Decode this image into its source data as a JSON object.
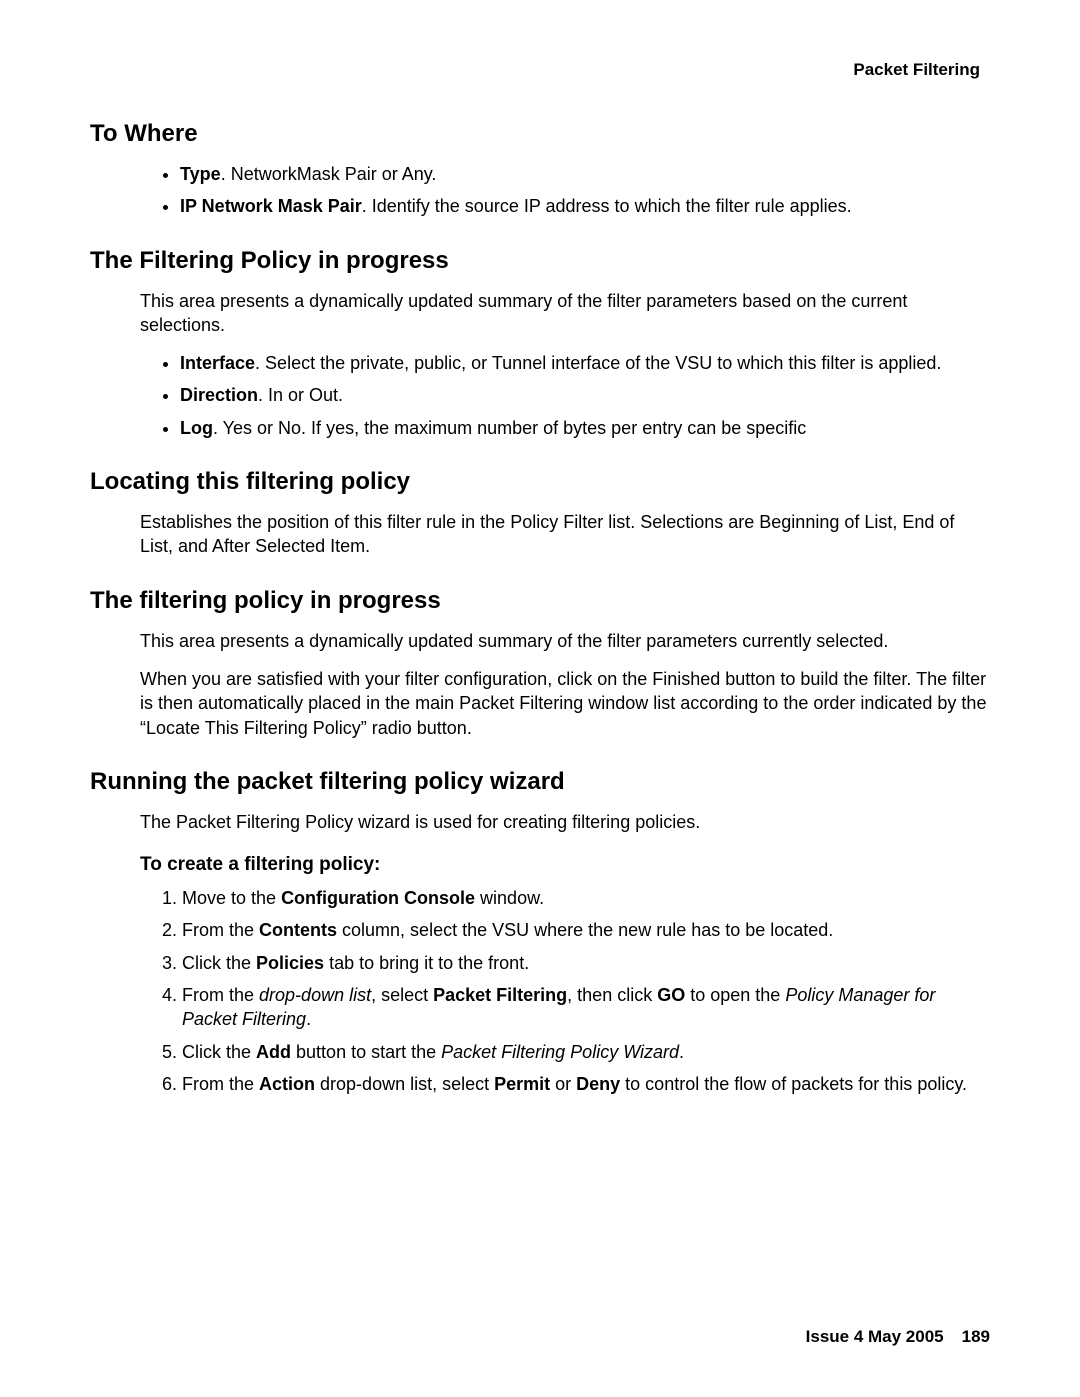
{
  "header": {
    "title": "Packet Filtering"
  },
  "sections": {
    "to_where": {
      "heading": "To Where",
      "bullets": {
        "type_label": "Type",
        "type_text": ". NetworkMask Pair or Any.",
        "ipm_label": "IP Network Mask Pair",
        "ipm_text": ". Identify the source IP address to which the filter rule applies."
      }
    },
    "filtering_progress_upper": {
      "heading": "The Filtering Policy in progress",
      "intro": "This area presents a dynamically updated summary of the filter parameters based on the current selections.",
      "bullets": {
        "interface_label": "Interface",
        "interface_text": ". Select the private, public, or Tunnel interface of the VSU to which this filter is applied.",
        "direction_label": "Direction",
        "direction_text": ". In or Out.",
        "log_label": "Log",
        "log_text": ". Yes or No. If yes, the maximum number of bytes per entry can be specific"
      }
    },
    "locating": {
      "heading": "Locating this filtering policy",
      "para": "Establishes the position of this filter rule in the Policy Filter list. Selections are Beginning of List, End of List, and After Selected Item."
    },
    "filtering_progress_lower": {
      "heading": "The filtering policy in progress",
      "para1": "This area presents a dynamically updated summary of the filter parameters currently selected.",
      "para2": "When you are satisfied with your filter configuration, click on the Finished button to build the filter. The filter is then automatically placed in the main Packet Filtering window list according to the order indicated by the “Locate This Filtering Policy” radio button."
    },
    "running_wizard": {
      "heading": "Running the packet filtering policy wizard",
      "intro": "The Packet Filtering Policy wizard is used for creating filtering policies.",
      "subhead": "To create a filtering policy:",
      "steps": {
        "s1a": "Move to the ",
        "s1b": "Configuration Console",
        "s1c": " window.",
        "s2a": "From the ",
        "s2b": "Contents",
        "s2c": " column, select the VSU where the new rule has to be located.",
        "s3a": "Click the ",
        "s3b": "Policies",
        "s3c": " tab to bring it to the front.",
        "s4a": "From the ",
        "s4b": "drop-down list",
        "s4c": ", select ",
        "s4d": "Packet Filtering",
        "s4e": ", then click ",
        "s4f": "GO",
        "s4g": " to open the ",
        "s4h": "Policy Manager for Packet Filtering",
        "s4i": ".",
        "s5a": "Click the ",
        "s5b": "Add",
        "s5c": " button to start the ",
        "s5d": "Packet Filtering Policy Wizard",
        "s5e": ".",
        "s6a": "From the ",
        "s6b": "Action",
        "s6c": " drop-down list, select ",
        "s6d": "Permit",
        "s6e": " or ",
        "s6f": "Deny",
        "s6g": " to control the flow of packets for this policy."
      }
    }
  },
  "footer": {
    "issue": "Issue 4   May 2005",
    "page": "189"
  }
}
